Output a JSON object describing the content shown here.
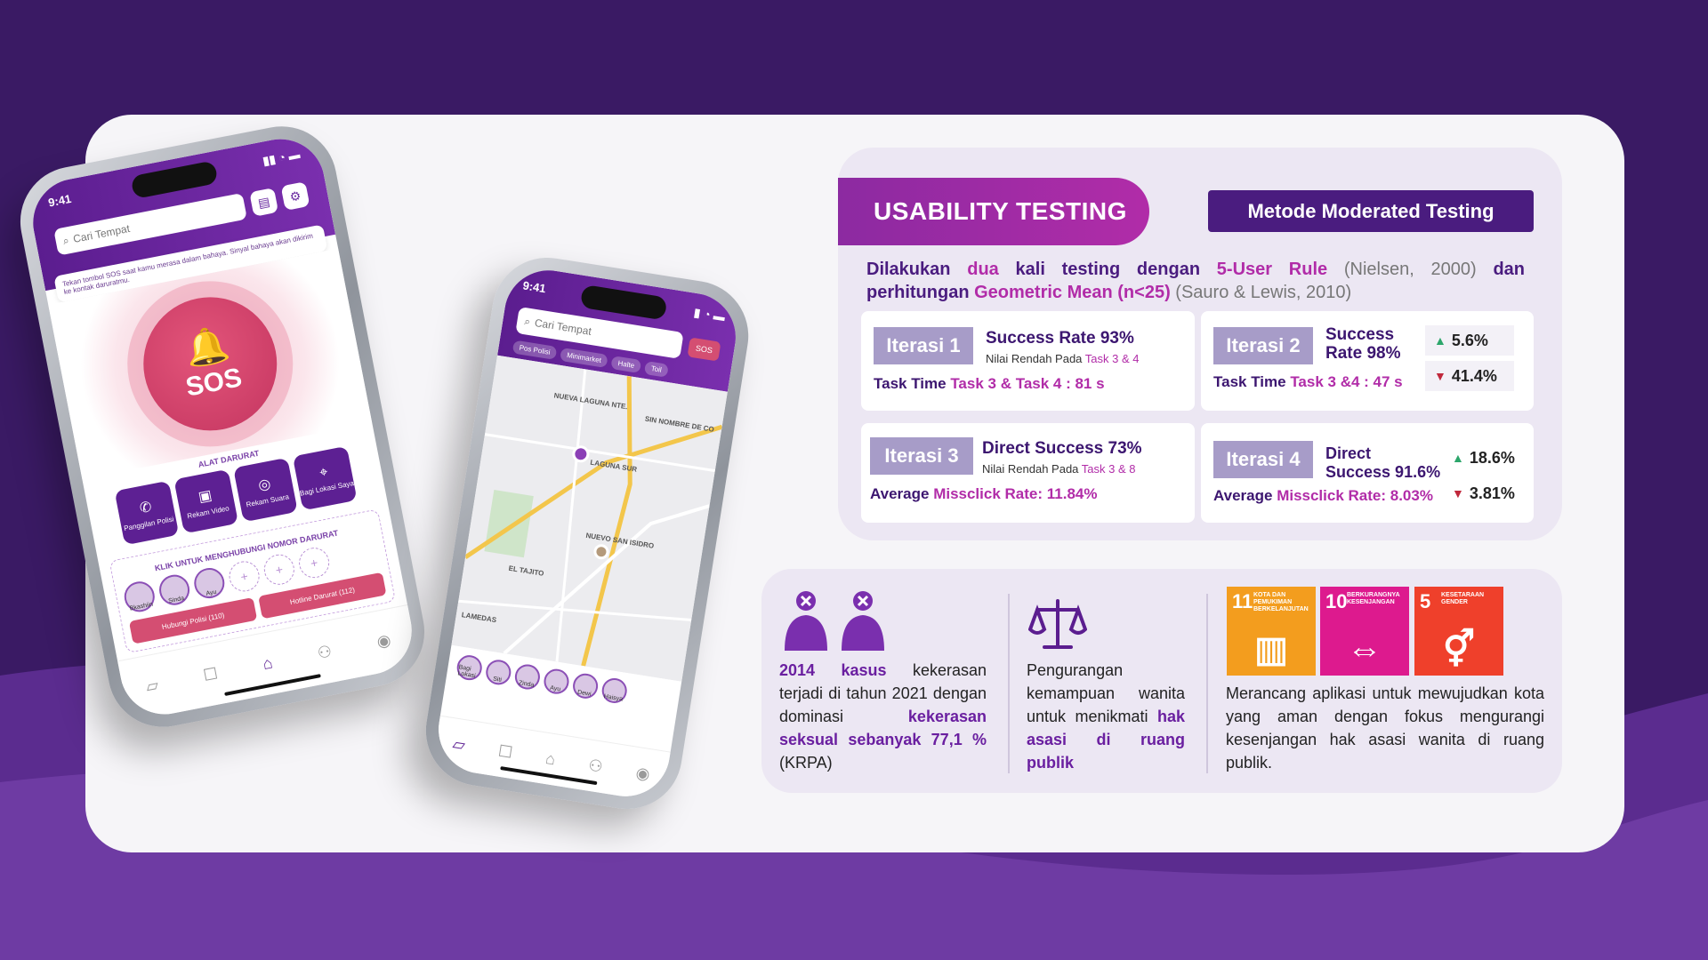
{
  "phone1": {
    "time": "9:41",
    "search_placeholder": "Cari Tempat",
    "notice": "Tekan tombol SOS saat kamu merasa dalam bahaya. Sinyal bahaya akan dikirim ke kontak daruratmu.",
    "sos_label": "SOS",
    "tools_title": "ALAT DARURAT",
    "tools": [
      "Panggilan Polisi",
      "Rekam Video",
      "Rekam Suara",
      "Bagi Lokasi Saya"
    ],
    "contacts_title": "KLIK UNTUK MENGHUBUNGI NOMOR DARURAT",
    "contacts": [
      "Bkashiin",
      "Sinda",
      "Ayu"
    ],
    "hotlines": [
      "Hubungi Polisi (110)",
      "Hotline Darurat (112)"
    ]
  },
  "phone2": {
    "time": "9:41",
    "search_placeholder": "Cari Tempat",
    "sos_label": "SOS",
    "chips": [
      "Pos Polisi",
      "Minimarket",
      "Halte",
      "Toil"
    ],
    "map_labels": [
      "NUEVA LAGUNA NTE.",
      "SIN NOMBRE DE CO",
      "LAGUNA SUR",
      "NUEVO SAN ISIDRO",
      "EL TAJITO",
      "LAMEDAS"
    ],
    "contacts": [
      "Bagi Lokasi",
      "Siti",
      "Zinda",
      "Ayu",
      "Dewi",
      "Haisya"
    ]
  },
  "usability": {
    "title": "USABILITY TESTING",
    "method": "Metode Moderated Testing",
    "desc": {
      "a": "Dilakukan ",
      "b": "dua",
      "c": " kali testing dengan ",
      "d": "5-User Rule",
      "e": " (Nielsen, 2000)",
      "f": " dan perhitungan ",
      "g": "Geometric Mean (n<25)",
      "h": " (Sauro & Lewis, 2010)"
    },
    "iterations": [
      {
        "badge": "Iterasi 1",
        "main": "Success Rate 93%",
        "sub_a": "Nilai Rendah Pada ",
        "sub_b": "Task 3 & 4",
        "line_a": "Task Time ",
        "line_b": "Task 3 & Task 4 : 81 s"
      },
      {
        "badge": "Iterasi 2",
        "main_1": "Success",
        "main_2": "Rate 98%",
        "line_a": "Task Time ",
        "line_b": "Task 3 &4 : 47 s",
        "up": "5.6%",
        "down": "41.4%"
      },
      {
        "badge": "Iterasi 3",
        "main": "Direct Success 73%",
        "sub_a": "Nilai Rendah Pada ",
        "sub_b": "Task 3 & 8",
        "line_a": "Average ",
        "line_b": "Missclick Rate: 11.84%"
      },
      {
        "badge": "Iterasi 4",
        "main_1": "Direct",
        "main_2": "Success 91.6%",
        "line_a": "Average ",
        "line_b": "Missclick Rate: 8.03%",
        "up": "18.6%",
        "down": "3.81%"
      }
    ]
  },
  "info": {
    "col1": {
      "a": "2014 kasus",
      "b": " kekerasan terjadi di tahun 2021 dengan dominasi ",
      "c": "kekerasan seksual sebanyak 77,1 %",
      "d": " (KRPA)"
    },
    "col2": {
      "a": "Pengurangan kemampuan wanita untuk menikmati ",
      "b": "hak asasi di ruang publik"
    },
    "col3": "Merancang aplikasi untuk mewujudkan kota yang aman dengan fokus mengurangi kesenjangan hak asasi wanita di ruang publik.",
    "sdgs": [
      {
        "num": "11",
        "name": "KOTA DAN PEMUKIMAN BERKELANJUTAN",
        "color": "#f39d1e",
        "icon": "building-icon"
      },
      {
        "num": "10",
        "name": "BERKURANGNYA KESENJANGAN",
        "color": "#dd1a8e",
        "icon": "equality-arrows-icon"
      },
      {
        "num": "5",
        "name": "KESETARAAN GENDER",
        "color": "#ef402b",
        "icon": "gender-icon"
      }
    ]
  },
  "colors": {
    "bg": "#3a1a64",
    "accent": "#b12ca8",
    "primary": "#4a1c7f"
  }
}
